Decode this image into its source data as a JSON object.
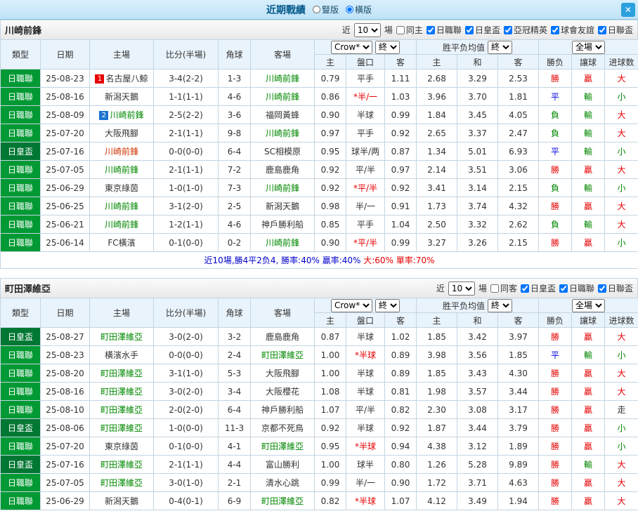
{
  "titlebar": {
    "title": "近期戰績",
    "radios": [
      {
        "label": "豎版",
        "selected": false
      },
      {
        "label": "橫版",
        "selected": true
      }
    ],
    "close_label": "✕"
  },
  "columns": {
    "main": [
      "類型",
      "日期",
      "主場",
      "比分(半場)",
      "角球",
      "客場"
    ],
    "bookmaker_select": "Crow*",
    "final_select": "終",
    "avg_group_label": "胜平负均值",
    "full_select": "全場",
    "sub": [
      "主",
      "盤口",
      "客",
      "主",
      "和",
      "客",
      "勝负",
      "讓球",
      "进球数"
    ]
  },
  "sections": [
    {
      "team": "川崎前鋒",
      "near_label": "近",
      "games_count": "10",
      "games_label": "場",
      "filters": [
        {
          "label": "同主",
          "checked": false
        },
        {
          "label": "日職聯",
          "checked": true
        },
        {
          "label": "日皇盃",
          "checked": true
        },
        {
          "label": "亞冠精英",
          "checked": true
        },
        {
          "label": "球會友誼",
          "checked": true
        },
        {
          "label": "日聯盃",
          "checked": true
        }
      ],
      "rows": [
        {
          "lg": "日職聯",
          "lgc": "#009933",
          "date": "25-08-23",
          "badge": "1",
          "badgec": "#e60000",
          "home": "名古屋八鯨",
          "homec": "#333333",
          "score": "3-4(2-2)",
          "corner": "1-3",
          "away": "川崎前鋒",
          "awayc": "#008800",
          "o1": "0.79",
          "hc": "平手",
          "hcc": "#333333",
          "o2": "1.11",
          "a1": "2.68",
          "a2": "3.29",
          "a3": "2.53",
          "r1": "勝",
          "r1c": "#e60000",
          "r2": "贏",
          "r2c": "#e60000",
          "r3": "大",
          "r3c": "#e60000"
        },
        {
          "lg": "日職聯",
          "lgc": "#009933",
          "date": "25-08-16",
          "badge": "",
          "badgec": "",
          "home": "新潟天鵝",
          "homec": "#333333",
          "score": "1-1(1-1)",
          "corner": "4-6",
          "away": "川崎前鋒",
          "awayc": "#008800",
          "o1": "0.86",
          "hc": "*半/一",
          "hcc": "#e60000",
          "o2": "1.03",
          "a1": "3.96",
          "a2": "3.70",
          "a3": "1.81",
          "r1": "平",
          "r1c": "#0000dd",
          "r2": "輸",
          "r2c": "#008800",
          "r3": "小",
          "r3c": "#008800"
        },
        {
          "lg": "日職聯",
          "lgc": "#009933",
          "date": "25-08-09",
          "badge": "2",
          "badgec": "#1b75d1",
          "home": "川崎前鋒",
          "homec": "#008800",
          "score": "2-5(2-2)",
          "corner": "3-6",
          "away": "福岡黃蜂",
          "awayc": "#333333",
          "o1": "0.90",
          "hc": "半球",
          "hcc": "#333333",
          "o2": "0.99",
          "a1": "1.84",
          "a2": "3.45",
          "a3": "4.05",
          "r1": "負",
          "r1c": "#008800",
          "r2": "輸",
          "r2c": "#008800",
          "r3": "大",
          "r3c": "#e60000"
        },
        {
          "lg": "日職聯",
          "lgc": "#009933",
          "date": "25-07-20",
          "badge": "",
          "badgec": "",
          "home": "大阪飛腳",
          "homec": "#333333",
          "score": "2-1(1-1)",
          "corner": "9-8",
          "away": "川崎前鋒",
          "awayc": "#008800",
          "o1": "0.97",
          "hc": "平手",
          "hcc": "#333333",
          "o2": "0.92",
          "a1": "2.65",
          "a2": "3.37",
          "a3": "2.47",
          "r1": "負",
          "r1c": "#008800",
          "r2": "輸",
          "r2c": "#008800",
          "r3": "大",
          "r3c": "#e60000"
        },
        {
          "lg": "日皇盃",
          "lgc": "#007733",
          "date": "25-07-16",
          "badge": "",
          "badgec": "",
          "home": "川崎前鋒",
          "homec": "#cc3300",
          "score": "0-0(0-0)",
          "corner": "6-4",
          "away": "SC相模原",
          "awayc": "#333333",
          "o1": "0.95",
          "hc": "球半/两",
          "hcc": "#333333",
          "o2": "0.87",
          "a1": "1.34",
          "a2": "5.01",
          "a3": "6.93",
          "r1": "平",
          "r1c": "#0000dd",
          "r2": "輸",
          "r2c": "#008800",
          "r3": "小",
          "r3c": "#008800"
        },
        {
          "lg": "日職聯",
          "lgc": "#009933",
          "date": "25-07-05",
          "badge": "",
          "badgec": "",
          "home": "川崎前鋒",
          "homec": "#008800",
          "score": "2-1(1-1)",
          "corner": "7-2",
          "away": "鹿島鹿角",
          "awayc": "#333333",
          "o1": "0.92",
          "hc": "平/半",
          "hcc": "#333333",
          "o2": "0.97",
          "a1": "2.14",
          "a2": "3.51",
          "a3": "3.06",
          "r1": "勝",
          "r1c": "#e60000",
          "r2": "贏",
          "r2c": "#e60000",
          "r3": "大",
          "r3c": "#e60000"
        },
        {
          "lg": "日職聯",
          "lgc": "#009933",
          "date": "25-06-29",
          "badge": "",
          "badgec": "",
          "home": "東京綠茵",
          "homec": "#333333",
          "score": "1-0(1-0)",
          "corner": "7-3",
          "away": "川崎前鋒",
          "awayc": "#008800",
          "o1": "0.92",
          "hc": "*平/半",
          "hcc": "#e60000",
          "o2": "0.92",
          "a1": "3.41",
          "a2": "3.14",
          "a3": "2.15",
          "r1": "負",
          "r1c": "#008800",
          "r2": "輸",
          "r2c": "#008800",
          "r3": "小",
          "r3c": "#008800"
        },
        {
          "lg": "日職聯",
          "lgc": "#009933",
          "date": "25-06-25",
          "badge": "",
          "badgec": "",
          "home": "川崎前鋒",
          "homec": "#008800",
          "score": "3-1(2-0)",
          "corner": "2-5",
          "away": "新潟天鵝",
          "awayc": "#333333",
          "o1": "0.98",
          "hc": "半/一",
          "hcc": "#333333",
          "o2": "0.91",
          "a1": "1.73",
          "a2": "3.74",
          "a3": "4.32",
          "r1": "勝",
          "r1c": "#e60000",
          "r2": "贏",
          "r2c": "#e60000",
          "r3": "大",
          "r3c": "#e60000"
        },
        {
          "lg": "日職聯",
          "lgc": "#009933",
          "date": "25-06-21",
          "badge": "",
          "badgec": "",
          "home": "川崎前鋒",
          "homec": "#008800",
          "score": "1-2(1-1)",
          "corner": "4-6",
          "away": "神戶勝利船",
          "awayc": "#333333",
          "o1": "0.85",
          "hc": "平手",
          "hcc": "#333333",
          "o2": "1.04",
          "a1": "2.50",
          "a2": "3.32",
          "a3": "2.62",
          "r1": "負",
          "r1c": "#008800",
          "r2": "輸",
          "r2c": "#008800",
          "r3": "大",
          "r3c": "#e60000"
        },
        {
          "lg": "日職聯",
          "lgc": "#009933",
          "date": "25-06-14",
          "badge": "",
          "badgec": "",
          "home": "FC橫濱",
          "homec": "#333333",
          "score": "0-1(0-0)",
          "corner": "0-2",
          "away": "川崎前鋒",
          "awayc": "#008800",
          "o1": "0.90",
          "hc": "*平/半",
          "hcc": "#e60000",
          "o2": "0.99",
          "a1": "3.27",
          "a2": "3.26",
          "a3": "2.15",
          "r1": "勝",
          "r1c": "#e60000",
          "r2": "贏",
          "r2c": "#e60000",
          "r3": "小",
          "r3c": "#008800"
        }
      ],
      "summary": [
        {
          "text": "近10場,勝4平2负4, 勝率:40%",
          "color": "#0000cc"
        },
        {
          "text": " 贏率:40%",
          "color": "#0000cc"
        },
        {
          "text": " 大:60%",
          "color": "#e60000"
        },
        {
          "text": " 單率:70%",
          "color": "#e60000"
        }
      ]
    },
    {
      "team": "町田澤維亞",
      "near_label": "近",
      "games_count": "10",
      "games_label": "場",
      "filters": [
        {
          "label": "同客",
          "checked": false
        },
        {
          "label": "日皇盃",
          "checked": true
        },
        {
          "label": "日職聯",
          "checked": true
        },
        {
          "label": "日聯盃",
          "checked": true
        }
      ],
      "rows": [
        {
          "lg": "日皇盃",
          "lgc": "#007733",
          "date": "25-08-27",
          "badge": "",
          "badgec": "",
          "home": "町田澤維亞",
          "homec": "#008800",
          "score": "3-0(2-0)",
          "corner": "3-2",
          "away": "鹿島鹿角",
          "awayc": "#333333",
          "o1": "0.87",
          "hc": "半球",
          "hcc": "#333333",
          "o2": "1.02",
          "a1": "1.85",
          "a2": "3.42",
          "a3": "3.97",
          "r1": "勝",
          "r1c": "#e60000",
          "r2": "贏",
          "r2c": "#e60000",
          "r3": "大",
          "r3c": "#e60000"
        },
        {
          "lg": "日職聯",
          "lgc": "#009933",
          "date": "25-08-23",
          "badge": "",
          "badgec": "",
          "home": "橫濱水手",
          "homec": "#333333",
          "score": "0-0(0-0)",
          "corner": "2-4",
          "away": "町田澤維亞",
          "awayc": "#008800",
          "o1": "1.00",
          "hc": "*半球",
          "hcc": "#e60000",
          "o2": "0.89",
          "a1": "3.98",
          "a2": "3.56",
          "a3": "1.85",
          "r1": "平",
          "r1c": "#0000dd",
          "r2": "輸",
          "r2c": "#008800",
          "r3": "小",
          "r3c": "#008800"
        },
        {
          "lg": "日職聯",
          "lgc": "#009933",
          "date": "25-08-20",
          "badge": "",
          "badgec": "",
          "home": "町田澤維亞",
          "homec": "#008800",
          "score": "3-1(1-0)",
          "corner": "5-3",
          "away": "大阪飛腳",
          "awayc": "#333333",
          "o1": "1.00",
          "hc": "半球",
          "hcc": "#333333",
          "o2": "0.89",
          "a1": "1.85",
          "a2": "3.43",
          "a3": "4.30",
          "r1": "勝",
          "r1c": "#e60000",
          "r2": "贏",
          "r2c": "#e60000",
          "r3": "大",
          "r3c": "#e60000"
        },
        {
          "lg": "日職聯",
          "lgc": "#009933",
          "date": "25-08-16",
          "badge": "",
          "badgec": "",
          "home": "町田澤維亞",
          "homec": "#008800",
          "score": "3-0(2-0)",
          "corner": "3-4",
          "away": "大阪櫻花",
          "awayc": "#333333",
          "o1": "1.08",
          "hc": "半球",
          "hcc": "#333333",
          "o2": "0.81",
          "a1": "1.98",
          "a2": "3.57",
          "a3": "3.44",
          "r1": "勝",
          "r1c": "#e60000",
          "r2": "贏",
          "r2c": "#e60000",
          "r3": "大",
          "r3c": "#e60000"
        },
        {
          "lg": "日職聯",
          "lgc": "#009933",
          "date": "25-08-10",
          "badge": "",
          "badgec": "",
          "home": "町田澤維亞",
          "homec": "#008800",
          "score": "2-0(2-0)",
          "corner": "6-4",
          "away": "神戶勝利船",
          "awayc": "#333333",
          "o1": "1.07",
          "hc": "平/半",
          "hcc": "#333333",
          "o2": "0.82",
          "a1": "2.30",
          "a2": "3.08",
          "a3": "3.17",
          "r1": "勝",
          "r1c": "#e60000",
          "r2": "贏",
          "r2c": "#e60000",
          "r3": "走",
          "r3c": "#333333"
        },
        {
          "lg": "日皇盃",
          "lgc": "#007733",
          "date": "25-08-06",
          "badge": "",
          "badgec": "",
          "home": "町田澤維亞",
          "homec": "#008800",
          "score": "1-0(0-0)",
          "corner": "11-3",
          "away": "京都不死鳥",
          "awayc": "#333333",
          "o1": "0.92",
          "hc": "半球",
          "hcc": "#333333",
          "o2": "0.92",
          "a1": "1.87",
          "a2": "3.44",
          "a3": "3.79",
          "r1": "勝",
          "r1c": "#e60000",
          "r2": "贏",
          "r2c": "#e60000",
          "r3": "小",
          "r3c": "#008800"
        },
        {
          "lg": "日職聯",
          "lgc": "#009933",
          "date": "25-07-20",
          "badge": "",
          "badgec": "",
          "home": "東京綠茵",
          "homec": "#333333",
          "score": "0-1(0-0)",
          "corner": "4-1",
          "away": "町田澤維亞",
          "awayc": "#008800",
          "o1": "0.95",
          "hc": "*半球",
          "hcc": "#e60000",
          "o2": "0.94",
          "a1": "4.38",
          "a2": "3.12",
          "a3": "1.89",
          "r1": "勝",
          "r1c": "#e60000",
          "r2": "贏",
          "r2c": "#e60000",
          "r3": "小",
          "r3c": "#008800"
        },
        {
          "lg": "日皇盃",
          "lgc": "#007733",
          "date": "25-07-16",
          "badge": "",
          "badgec": "",
          "home": "町田澤維亞",
          "homec": "#008800",
          "score": "2-1(1-1)",
          "corner": "4-4",
          "away": "富山勝利",
          "awayc": "#333333",
          "o1": "1.00",
          "hc": "球半",
          "hcc": "#333333",
          "o2": "0.80",
          "a1": "1.26",
          "a2": "5.28",
          "a3": "9.89",
          "r1": "勝",
          "r1c": "#e60000",
          "r2": "輸",
          "r2c": "#008800",
          "r3": "大",
          "r3c": "#e60000"
        },
        {
          "lg": "日職聯",
          "lgc": "#009933",
          "date": "25-07-05",
          "badge": "",
          "badgec": "",
          "home": "町田澤維亞",
          "homec": "#008800",
          "score": "3-0(1-0)",
          "corner": "2-1",
          "away": "清水心跳",
          "awayc": "#333333",
          "o1": "0.99",
          "hc": "半/一",
          "hcc": "#333333",
          "o2": "0.90",
          "a1": "1.72",
          "a2": "3.71",
          "a3": "4.63",
          "r1": "勝",
          "r1c": "#e60000",
          "r2": "贏",
          "r2c": "#e60000",
          "r3": "大",
          "r3c": "#e60000"
        },
        {
          "lg": "日職聯",
          "lgc": "#009933",
          "date": "25-06-29",
          "badge": "",
          "badgec": "",
          "home": "新潟天鵝",
          "homec": "#333333",
          "score": "0-4(0-1)",
          "corner": "6-9",
          "away": "町田澤維亞",
          "awayc": "#008800",
          "o1": "0.82",
          "hc": "*半球",
          "hcc": "#e60000",
          "o2": "1.07",
          "a1": "4.12",
          "a2": "3.49",
          "a3": "1.94",
          "r1": "勝",
          "r1c": "#e60000",
          "r2": "贏",
          "r2c": "#e60000",
          "r3": "大",
          "r3c": "#e60000"
        }
      ],
      "summary": null
    }
  ]
}
